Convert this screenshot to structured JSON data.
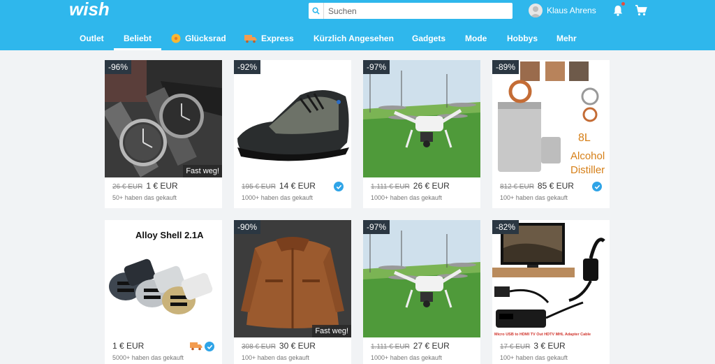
{
  "header": {
    "logo": "wish",
    "search_placeholder": "Suchen",
    "user_name": "Klaus Ahrens"
  },
  "nav": [
    {
      "label": "Outlet"
    },
    {
      "label": "Beliebt",
      "active": true
    },
    {
      "label": "Glücksrad",
      "icon": "wheel-icon"
    },
    {
      "label": "Express",
      "icon": "truck-icon"
    },
    {
      "label": "Kürzlich Angesehen"
    },
    {
      "label": "Gadgets"
    },
    {
      "label": "Mode"
    },
    {
      "label": "Hobbys"
    },
    {
      "label": "Mehr"
    }
  ],
  "products": [
    {
      "discount": "-96%",
      "old_price": "26 € EUR",
      "price": "1 € EUR",
      "sold": "50+ haben das gekauft",
      "fast": "Fast weg!",
      "image": "watches"
    },
    {
      "discount": "-92%",
      "old_price": "195 € EUR",
      "price": "14 € EUR",
      "sold": "1000+ haben das gekauft",
      "verified": true,
      "image": "shoe"
    },
    {
      "discount": "-97%",
      "old_price": "1.111 € EUR",
      "price": "26 € EUR",
      "sold": "1000+ haben das gekauft",
      "image": "drone"
    },
    {
      "discount": "-89%",
      "old_price": "812 € EUR",
      "price": "85 € EUR",
      "sold": "100+ haben das gekauft",
      "verified": true,
      "image": "distiller",
      "image_text": [
        "8L",
        "Alcohol",
        "Distiller"
      ]
    },
    {
      "discount": "",
      "old_price": "",
      "price": "1 € EUR",
      "sold": "5000+ haben das gekauft",
      "verified": true,
      "express": true,
      "image": "charger",
      "image_text": [
        "Alloy Shell 2.1A"
      ]
    },
    {
      "discount": "-90%",
      "old_price": "308 € EUR",
      "price": "30 € EUR",
      "sold": "100+ haben das gekauft",
      "fast": "Fast weg!",
      "image": "jacket"
    },
    {
      "discount": "-97%",
      "old_price": "1.111 € EUR",
      "price": "27 € EUR",
      "sold": "1000+ haben das gekauft",
      "image": "drone"
    },
    {
      "discount": "-82%",
      "old_price": "17 € EUR",
      "price": "3 € EUR",
      "sold": "100+ haben das gekauft",
      "image": "hdmi",
      "image_text": [
        "Micro USB to HDMI TV Out HDTV MHL Adapter Cable"
      ]
    }
  ]
}
